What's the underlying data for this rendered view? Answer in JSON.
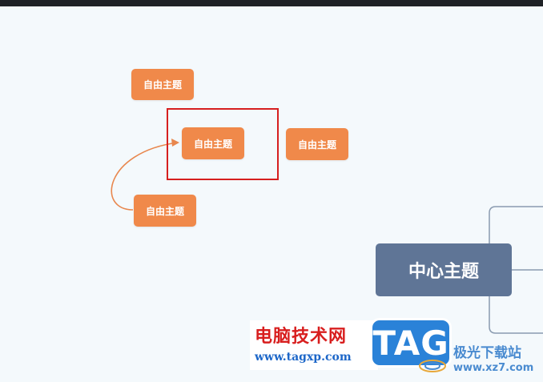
{
  "mindmap": {
    "floating_topics": [
      {
        "label": "自由主题"
      },
      {
        "label": "自由主题"
      },
      {
        "label": "自由主题"
      },
      {
        "label": "自由主题"
      }
    ],
    "central_topic": {
      "label": "中心主题"
    }
  },
  "colors": {
    "floating_topic": "#f0894a",
    "central_topic": "#5f7596",
    "selection": "#d61f1f",
    "connector": "#e8874e",
    "branch_line": "#8a9bb0"
  },
  "watermark": {
    "site_name": "电脑技术网",
    "site_url": "www.tagxp.com",
    "tag_logo": "TAG",
    "right_name": "极光下载站",
    "right_url": "www.xz7.com"
  }
}
